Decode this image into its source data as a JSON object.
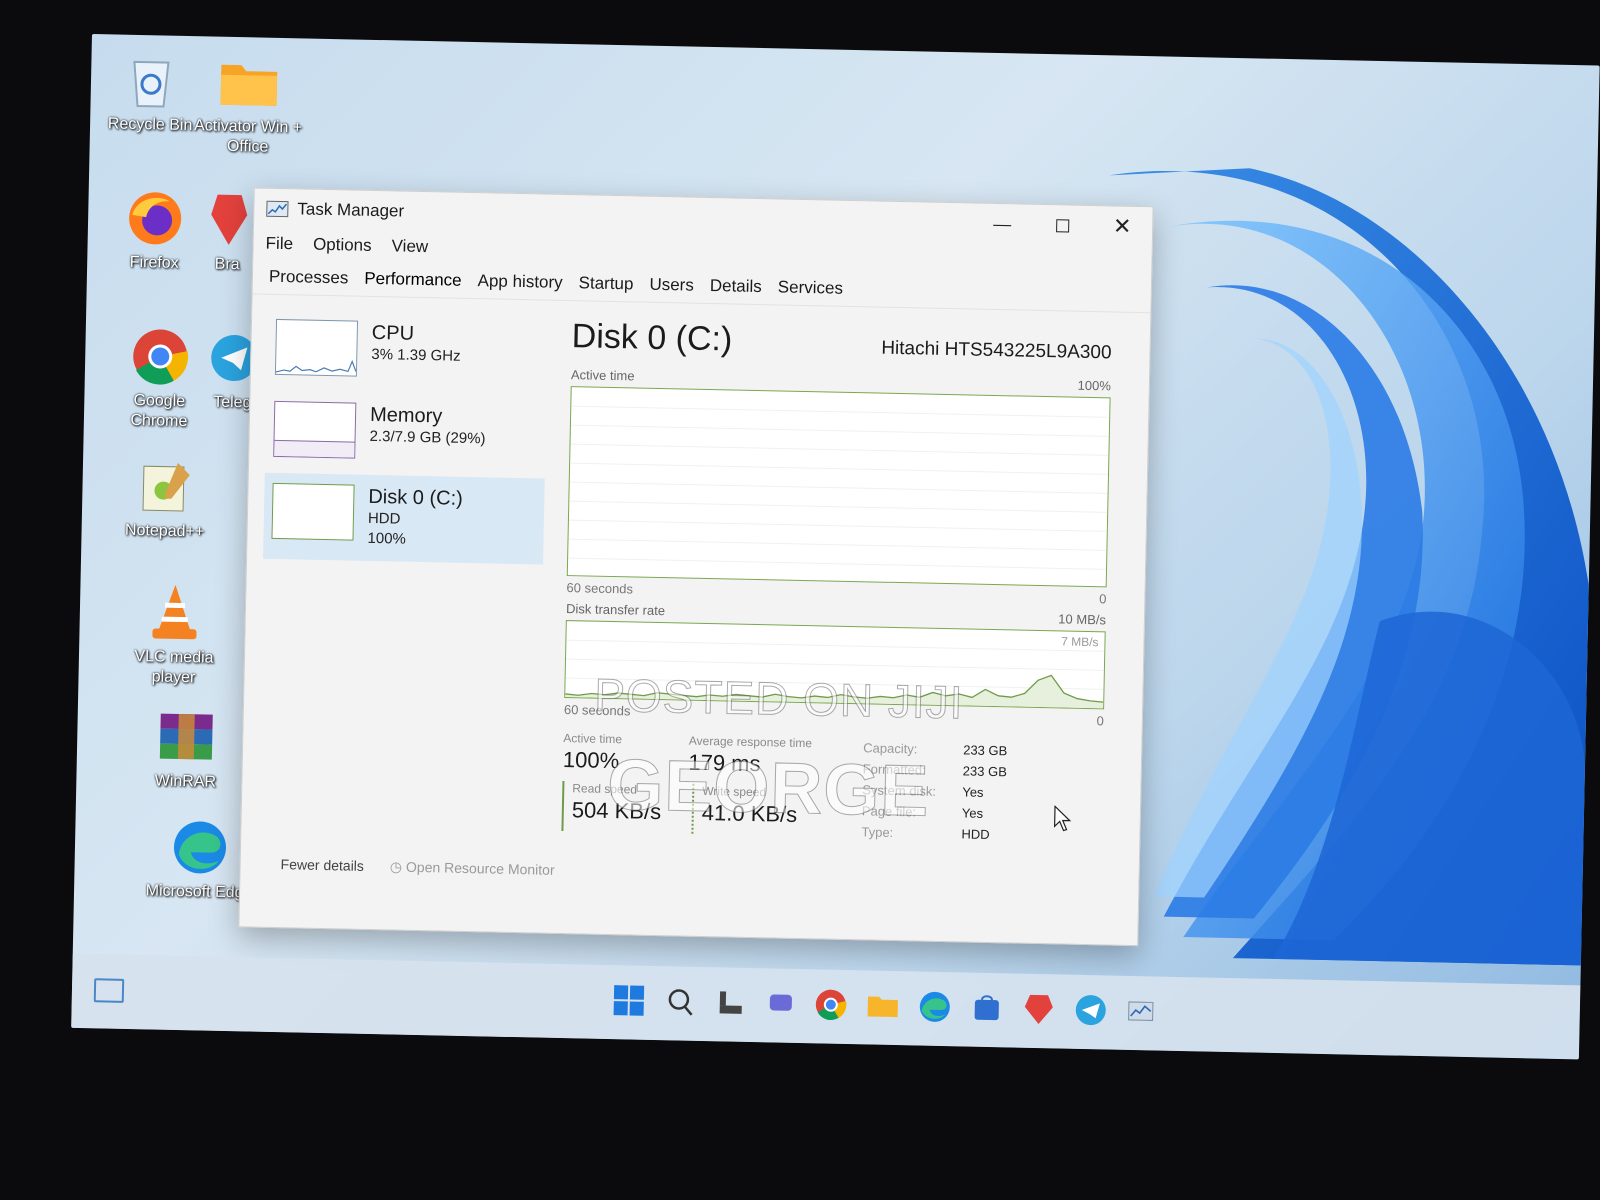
{
  "desktop": {
    "icons": [
      {
        "label": "Recycle Bin",
        "icon": "recycle-bin-icon"
      },
      {
        "label": "Activator Win + Office",
        "icon": "folder-icon"
      },
      {
        "label": "Firefox",
        "icon": "firefox-icon"
      },
      {
        "label": "Bra",
        "icon": "brave-icon"
      },
      {
        "label": "Google Chrome",
        "icon": "chrome-icon"
      },
      {
        "label": "Teleg",
        "icon": "telegram-icon"
      },
      {
        "label": "Notepad++",
        "icon": "notepadpp-icon"
      },
      {
        "label": "VLC media player",
        "icon": "vlc-icon"
      },
      {
        "label": "WinRAR",
        "icon": "winrar-icon"
      },
      {
        "label": "Microsoft Edge",
        "icon": "edge-icon"
      }
    ]
  },
  "window": {
    "title": "Task Manager",
    "menu": [
      "File",
      "Options",
      "View"
    ],
    "tabs": [
      "Processes",
      "Performance",
      "App history",
      "Startup",
      "Users",
      "Details",
      "Services"
    ],
    "active_tab": "Performance"
  },
  "sidebar": {
    "items": [
      {
        "name": "CPU",
        "sub1": "3%  1.39 GHz",
        "sub2": ""
      },
      {
        "name": "Memory",
        "sub1": "2.3/7.9 GB (29%)",
        "sub2": ""
      },
      {
        "name": "Disk 0 (C:)",
        "sub1": "HDD",
        "sub2": "100%"
      }
    ],
    "selected": "Disk 0 (C:)"
  },
  "main": {
    "title": "Disk 0 (C:)",
    "model": "Hitachi HTS543225L9A300",
    "graph1": {
      "label": "Active time",
      "max": "100%",
      "xlabel": "60 seconds",
      "min": "0"
    },
    "graph2": {
      "label": "Disk transfer rate",
      "max": "10 MB/s",
      "inner": "7 MB/s",
      "xlabel": "60 seconds",
      "min": "0"
    },
    "stats": {
      "active_time_label": "Active time",
      "active_time": "100%",
      "response_label": "Average response time",
      "response": "179 ms",
      "read_label": "Read speed",
      "read": "504 KB/s",
      "write_label": "Write speed",
      "write": "41.0 KB/s"
    },
    "props": [
      {
        "k": "Capacity:",
        "v": "233 GB"
      },
      {
        "k": "Formatted:",
        "v": "233 GB"
      },
      {
        "k": "System disk:",
        "v": "Yes"
      },
      {
        "k": "Page file:",
        "v": "Yes"
      },
      {
        "k": "Type:",
        "v": "HDD"
      }
    ]
  },
  "footer": {
    "fewer": "Fewer details",
    "monitor": "Open Resource Monitor"
  },
  "watermark": {
    "line1": "POSTED ON JIJI",
    "line2": "GEORGE"
  },
  "chart_data": {
    "type": "line",
    "series": [
      {
        "name": "Disk transfer rate",
        "values": [
          0.3,
          0.2,
          0.4,
          0.3,
          0.5,
          0.4,
          0.3,
          0.6,
          0.5,
          0.4,
          0.3,
          0.5,
          0.4,
          0.6,
          0.5,
          0.4,
          0.7,
          0.5,
          0.4,
          0.6,
          0.5,
          0.8,
          0.6,
          0.5,
          0.7,
          0.6,
          0.9,
          0.7,
          1.2,
          0.9,
          1.1,
          0.8,
          1.6,
          1.0,
          0.9,
          1.3,
          2.6,
          3.1,
          1.4,
          0.9,
          0.7,
          0.6
        ]
      }
    ],
    "ylim": [
      0,
      10
    ]
  },
  "colors": {
    "disk_green": "#6f9b4b",
    "cpu_blue": "#4a7fb5",
    "mem_purple": "#8a6ba6",
    "selected_bg": "#d9e8f5"
  }
}
